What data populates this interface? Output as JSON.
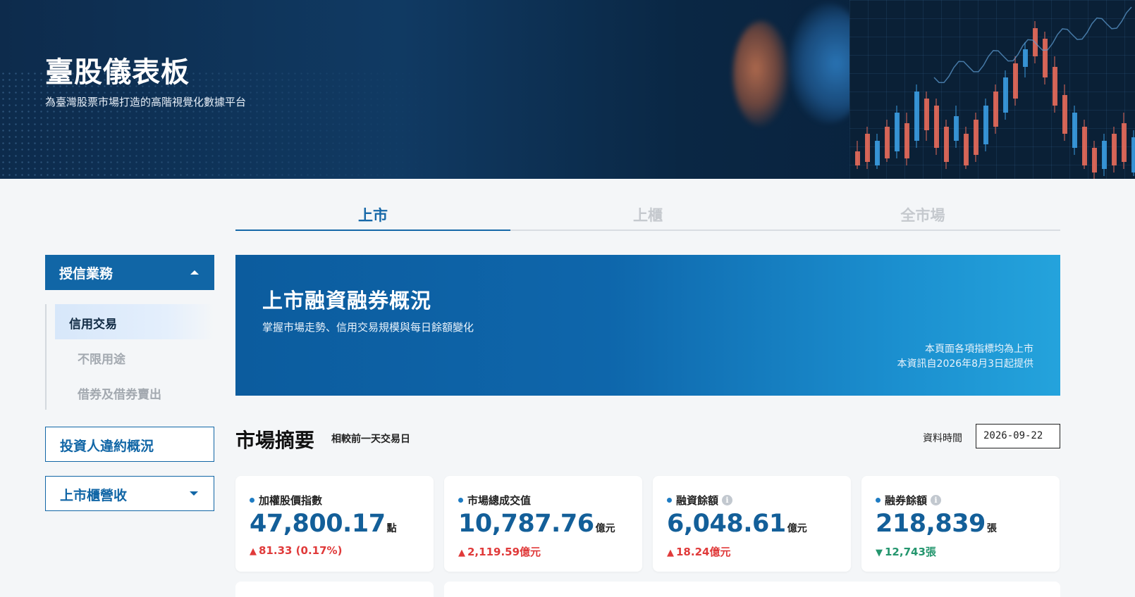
{
  "hero": {
    "title": "臺股儀表板",
    "subtitle": "為臺灣股票市場打造的高階視覺化數據平台"
  },
  "tabs": [
    {
      "label": "上市",
      "active": true
    },
    {
      "label": "上櫃",
      "active": false
    },
    {
      "label": "全市場",
      "active": false
    }
  ],
  "sidebar": {
    "section": {
      "label": "授信業務",
      "expanded": true
    },
    "items": [
      {
        "label": "信用交易",
        "active": true
      },
      {
        "label": "不限用途",
        "active": false
      },
      {
        "label": "借券及借券賣出",
        "active": false
      }
    ],
    "links": [
      {
        "label": "投資人違約概況"
      },
      {
        "label": "上市櫃營收",
        "has_dropdown": true
      }
    ]
  },
  "banner": {
    "title": "上市融資融券概況",
    "subtitle": "掌握市場走勢、信用交易規模與每日餘額變化",
    "note_line1": "本頁面各項指標均為上市",
    "note_line2": "本資訊自2026年8月3日起提供"
  },
  "summary": {
    "title": "市場摘要",
    "subtitle": "相較前一天交易日",
    "date_label": "資料時間",
    "date_value": "2026-09-22"
  },
  "cards": [
    {
      "label": "加權股價指數",
      "value": "47,800.17",
      "unit": "點",
      "change": "81.33 (0.17%)",
      "direction": "up",
      "info": false
    },
    {
      "label": "市場總成交值",
      "value": "10,787.76",
      "unit": "億元",
      "change": "2,119.59億元",
      "direction": "up",
      "info": false
    },
    {
      "label": "融資餘額",
      "value": "6,048.61",
      "unit": "億元",
      "change": "18.24億元",
      "direction": "up",
      "info": true
    },
    {
      "label": "融券餘額",
      "value": "218,839",
      "unit": "張",
      "change": "12,743張",
      "direction": "down",
      "info": true
    }
  ],
  "symbols": {
    "up_arrow": "▲",
    "down_arrow": "▼",
    "info_glyph": "i"
  },
  "colors": {
    "brand": "#1166a6",
    "value_blue": "#135f99",
    "up_red": "#e03a3a",
    "down_green": "#24966e"
  }
}
